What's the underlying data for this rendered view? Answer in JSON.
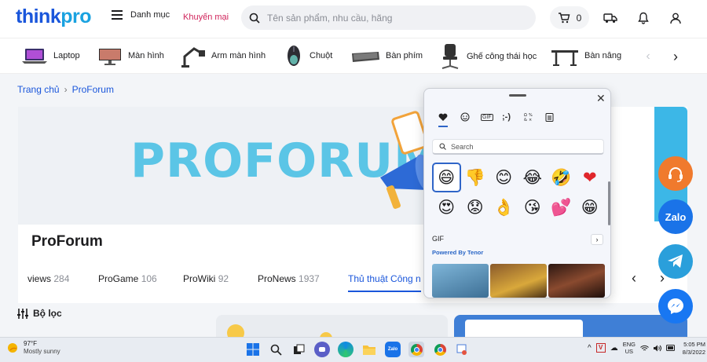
{
  "header": {
    "logo_think": "think",
    "logo_pro": "pro",
    "menu_label": "Danh mục",
    "promo_label": "Khuyến mại",
    "search_placeholder": "Tên sản phẩm, nhu cầu, hãng",
    "cart_count": "0"
  },
  "categories": {
    "items": [
      {
        "label": "Laptop",
        "icon": "laptop-icon"
      },
      {
        "label": "Màn hình",
        "icon": "monitor-icon"
      },
      {
        "label": "Arm màn hình",
        "icon": "monitor-arm-icon"
      },
      {
        "label": "Chuột",
        "icon": "mouse-icon"
      },
      {
        "label": "Bàn phím",
        "icon": "keyboard-icon"
      },
      {
        "label": "Ghế công thái học",
        "icon": "chair-icon"
      },
      {
        "label": "Bàn nâng",
        "icon": "desk-icon"
      }
    ]
  },
  "breadcrumb": {
    "home": "Trang chủ",
    "separator": "›",
    "current": "ProForum"
  },
  "banner": {
    "headline": "PROFORUM"
  },
  "forum": {
    "title": "ProForum",
    "tabs": [
      {
        "label": "views",
        "count": "284"
      },
      {
        "label": "ProGame",
        "count": "106"
      },
      {
        "label": "ProWiki",
        "count": "92"
      },
      {
        "label": "ProNews",
        "count": "1937"
      },
      {
        "label": "Thủ thuật Công n",
        "count": ""
      }
    ],
    "filter_label": "Bộ lọc"
  },
  "social": {
    "zalo_label": "Zalo"
  },
  "emoji_panel": {
    "close_glyph": "✕",
    "tabs": [
      "recent",
      "emoji",
      "gif",
      "kaomoji",
      "symbols",
      "clipboard"
    ],
    "search_placeholder": "Search",
    "emojis": [
      "😄",
      "👎",
      "😊",
      "😂",
      "🤣",
      "❤",
      "😍",
      "😟",
      "👌",
      "😘",
      "💕",
      "😁"
    ],
    "gif_label": "GIF",
    "gif_more": "›",
    "powered_by": "Powered By Tenor"
  },
  "taskbar": {
    "temperature": "97°F",
    "condition": "Mostly sunny",
    "lang_top": "ENG",
    "lang_bottom": "US",
    "time": "5:05 PM",
    "date": "8/3/2022"
  },
  "colors": {
    "brand_blue": "#1a56db",
    "promo_red": "#d0245b",
    "headline_blue": "#5bc5e6"
  }
}
